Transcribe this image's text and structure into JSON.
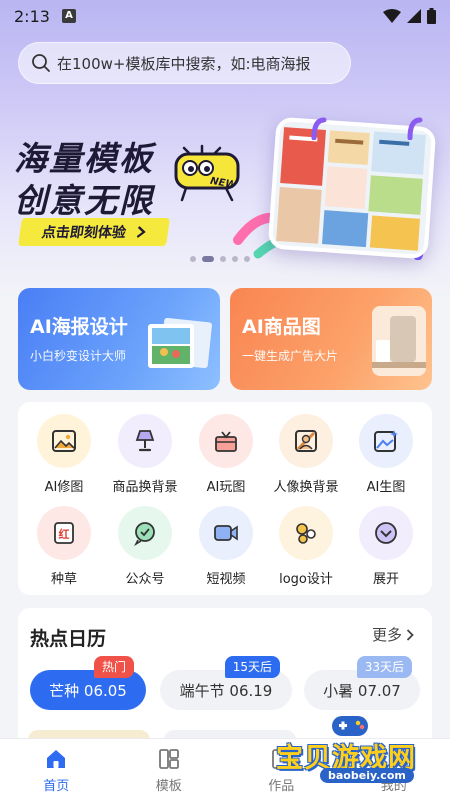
{
  "status_bar": {
    "time": "2:13",
    "a_label": "A"
  },
  "search": {
    "placeholder": "在100w+模板库中搜索，如:电商海报"
  },
  "banner": {
    "title_line1": "海量模板",
    "title_line2": "创意无限",
    "badge": "NEW",
    "cta": "点击即刻体验",
    "dots_count": 5,
    "active_dot": 1
  },
  "ai_cards": [
    {
      "title": "AI海报设计",
      "subtitle": "小白秒变设计大师"
    },
    {
      "title": "AI商品图",
      "subtitle": "一键生成广告大片"
    }
  ],
  "tools": [
    {
      "label": "AI修图",
      "icon": "image-edit-icon",
      "color": "#fff3d9"
    },
    {
      "label": "商品换背景",
      "icon": "lamp-icon",
      "color": "#f1edfc"
    },
    {
      "label": "AI玩图",
      "icon": "gift-box-icon",
      "color": "#fde8e6"
    },
    {
      "label": "人像换背景",
      "icon": "portrait-icon",
      "color": "#fdf0e1"
    },
    {
      "label": "AI生图",
      "icon": "ai-image-icon",
      "color": "#e9effd"
    },
    {
      "label": "种草",
      "icon": "red-note-icon",
      "color": "#fde8e6"
    },
    {
      "label": "公众号",
      "icon": "chat-bubble-icon",
      "color": "#e6f8ee"
    },
    {
      "label": "短视频",
      "icon": "video-camera-icon",
      "color": "#e9effd"
    },
    {
      "label": "logo设计",
      "icon": "shapes-icon",
      "color": "#fdf3de"
    },
    {
      "label": "展开",
      "icon": "expand-icon",
      "color": "#f1edfc"
    }
  ],
  "calendar": {
    "title": "热点日历",
    "more": "更多",
    "items": [
      {
        "label": "芒种 06.05",
        "badge": "热门",
        "badge_color": "#f0524a",
        "active": true
      },
      {
        "label": "端午节 06.19",
        "badge": "15天后",
        "badge_color": "#2d6cf0",
        "active": false
      },
      {
        "label": "小暑 07.07",
        "badge": "33天后",
        "badge_color": "#9ab8f2",
        "active": false
      }
    ]
  },
  "bottom_nav": [
    {
      "label": "首页",
      "active": true
    },
    {
      "label": "模板",
      "active": false
    },
    {
      "label": "作品",
      "active": false
    },
    {
      "label": "我的",
      "active": false
    }
  ],
  "watermark": {
    "name": "宝贝游戏网",
    "url": "baobeiy.com"
  },
  "colors": {
    "primary": "#2d6cf0",
    "hot": "#f0524a",
    "banner_cta": "#f5e93d"
  }
}
